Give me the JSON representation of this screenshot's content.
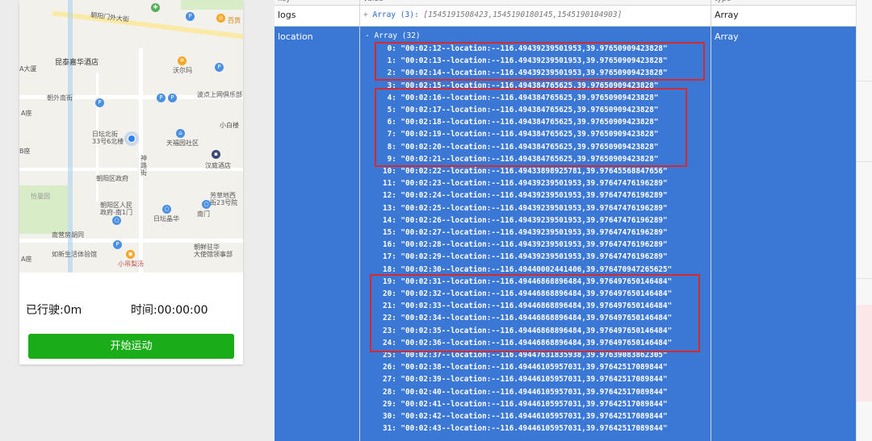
{
  "map": {
    "labels": {
      "l1": "朝阳门外大街",
      "l2": "昆泰嘉华酒店",
      "l3": "沃尔玛",
      "l4": "朝外南街",
      "l5": "波点上网俱乐部",
      "l6": "A座",
      "l7": "小白楼",
      "l8": "日坛北街\n33号6北楼",
      "l9": "天福园社区",
      "l10": "B座",
      "l11": "汉庭酒店",
      "l12": "朝阳区政府",
      "l13": "神路街",
      "l14": "恰曼园",
      "l15": "芳草地西\n街23号院",
      "l16": "朝阳区人民\n政府-南1门",
      "l17": "南门",
      "l18": "日坛晶华",
      "l19": "南营房胡同",
      "l20": "朝鲜驻华\n大使馆领事部",
      "l21": "如新生活体验馆",
      "l22": "小吊梨汤",
      "l23": "A座",
      "l24": "百货",
      "l25": "A大厦"
    }
  },
  "stats": {
    "distance": "已行驶:0m",
    "time": "时间:00:00:00"
  },
  "start_button": "开始运动",
  "inspector": {
    "header": {
      "key": "key",
      "value": "value",
      "type": "type"
    },
    "logs": {
      "key": "logs",
      "plus": "+",
      "array": "Array (3):",
      "value": "[1545191508423,1545190180145,1545190104903]",
      "type": "Array"
    },
    "location": {
      "key": "location",
      "head": "- Array (32)",
      "type": "Array",
      "entries": [
        " 0: \"00:02:12--location:--116.49439239501953,39.97650909423828\"",
        " 1: \"00:02:13--location:--116.49439239501953,39.97650909423828\"",
        " 2: \"00:02:14--location:--116.49439239501953,39.97650909423828\"",
        " 3: \"00:02:15--location:--116.494384765625,39.97650909423828\"",
        " 4: \"00:02:16--location:--116.494384765625,39.97650909423828\"",
        " 5: \"00:02:17--location:--116.494384765625,39.97650909423828\"",
        " 6: \"00:02:18--location:--116.494384765625,39.97650909423828\"",
        " 7: \"00:02:19--location:--116.494384765625,39.97650909423828\"",
        " 8: \"00:02:20--location:--116.494384765625,39.97650909423828\"",
        " 9: \"00:02:21--location:--116.494384765625,39.97650909423828\"",
        "10: \"00:02:22--location:--116.49433898925781,39.97645568847656\"",
        "11: \"00:02:23--location:--116.49439239501953,39.97647476196289\"",
        "12: \"00:02:24--location:--116.49439239501953,39.97647476196289\"",
        "13: \"00:02:25--location:--116.49439239501953,39.97647476196289\"",
        "14: \"00:02:26--location:--116.49439239501953,39.97647476196289\"",
        "15: \"00:02:27--location:--116.49439239501953,39.97647476196289\"",
        "16: \"00:02:28--location:--116.49439239501953,39.97647476196289\"",
        "17: \"00:02:29--location:--116.49439239501953,39.97647476196289\"",
        "18: \"00:02:30--location:--116.49440002441406,39.976470947265625\"",
        "19: \"00:02:31--location:--116.49446868896484,39.976497650146484\"",
        "20: \"00:02:32--location:--116.49446868896484,39.976497650146484\"",
        "21: \"00:02:33--location:--116.49446868896484,39.976497650146484\"",
        "22: \"00:02:34--location:--116.49446868896484,39.976497650146484\"",
        "23: \"00:02:35--location:--116.49446868896484,39.976497650146484\"",
        "24: \"00:02:36--location:--116.49446868896484,39.976497650146484\"",
        "25: \"00:02:37--location:--116.49447631835938,39.97639083862305\"",
        "26: \"00:02:38--location:--116.49446105957031,39.97642517089844\"",
        "27: \"00:02:39--location:--116.49446105957031,39.97642517089844\"",
        "28: \"00:02:40--location:--116.49446105957031,39.97642517089844\"",
        "29: \"00:02:41--location:--116.49446105957031,39.97642517089844\"",
        "30: \"00:02:42--location:--116.49446105957031,39.97642517089844\"",
        "31: \"00:02:43--location:--116.49446105957031,39.97642517089844\""
      ]
    }
  },
  "colors": {
    "accent_green": "#1aad19",
    "selected_row": "#3b78d6",
    "highlight_red": "#d9292b"
  }
}
